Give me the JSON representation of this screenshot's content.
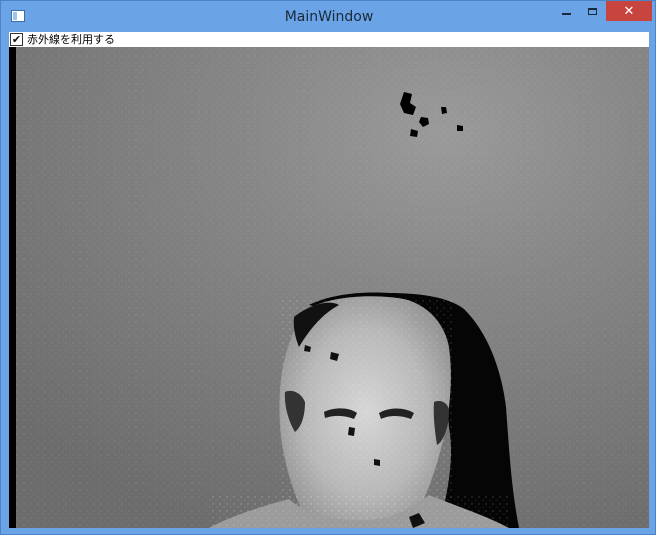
{
  "window": {
    "title": "MainWindow",
    "controls": {
      "minimize": "minimize",
      "maximize": "maximize",
      "close": "close"
    }
  },
  "options": {
    "use_infrared_label": "赤外線を利用する",
    "use_infrared_checked": true,
    "check_glyph": "✔"
  },
  "colors": {
    "window_frame": "#6aa4e6",
    "close_button": "#c7453e"
  },
  "icons": [
    "app-icon",
    "minimize-icon",
    "maximize-icon",
    "close-icon",
    "checkmark-icon"
  ]
}
